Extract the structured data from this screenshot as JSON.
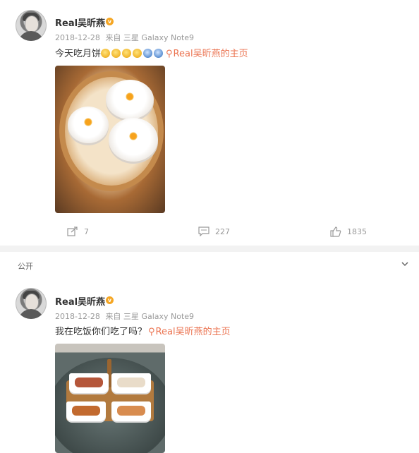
{
  "posts": [
    {
      "username": "Real吴昕燕",
      "timestamp": "2018-12-28",
      "source": "来自 三星 Galaxy Note9",
      "text": "今天吃月饼",
      "link_text": "Real吴昕燕的主页",
      "image_icon": "mooncake-steamer-photo",
      "actions": {
        "share_count": "7",
        "comment_count": "227",
        "like_count": "1835"
      }
    },
    {
      "visibility_label": "公开",
      "username": "Real吴昕燕",
      "timestamp": "2018-12-28",
      "source": "来自 三星 Galaxy Note9",
      "text": "我在吃饭你们吃了吗？",
      "link_text": "Real吴昕燕的主页",
      "image_icon": "dinner-table-photo"
    }
  ],
  "colors": {
    "link": "#eb7350",
    "meta": "#999999",
    "badge": "#f5a623"
  },
  "icons": {
    "share": "share-icon",
    "comment": "comment-icon",
    "like": "thumbs-up-icon",
    "expand": "chevron-down-icon"
  }
}
